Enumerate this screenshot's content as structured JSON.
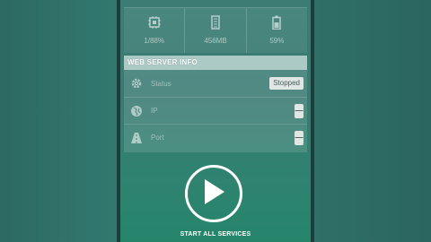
{
  "stats": {
    "cpu": "1/88%",
    "memory": "456MB",
    "battery": "59%"
  },
  "web_server_info": {
    "title": "WEB SERVER INFO",
    "status_label": "Status",
    "status_value": "Stopped",
    "ip_label": "IP",
    "ip_value": "—",
    "port_label": "Port",
    "port_value": "—"
  },
  "start_button": {
    "label": "START ALL SERVICES"
  },
  "colors": {
    "background": "#2f6f67",
    "panel_accent": "#25856b",
    "pill": "#dfe6e4"
  }
}
